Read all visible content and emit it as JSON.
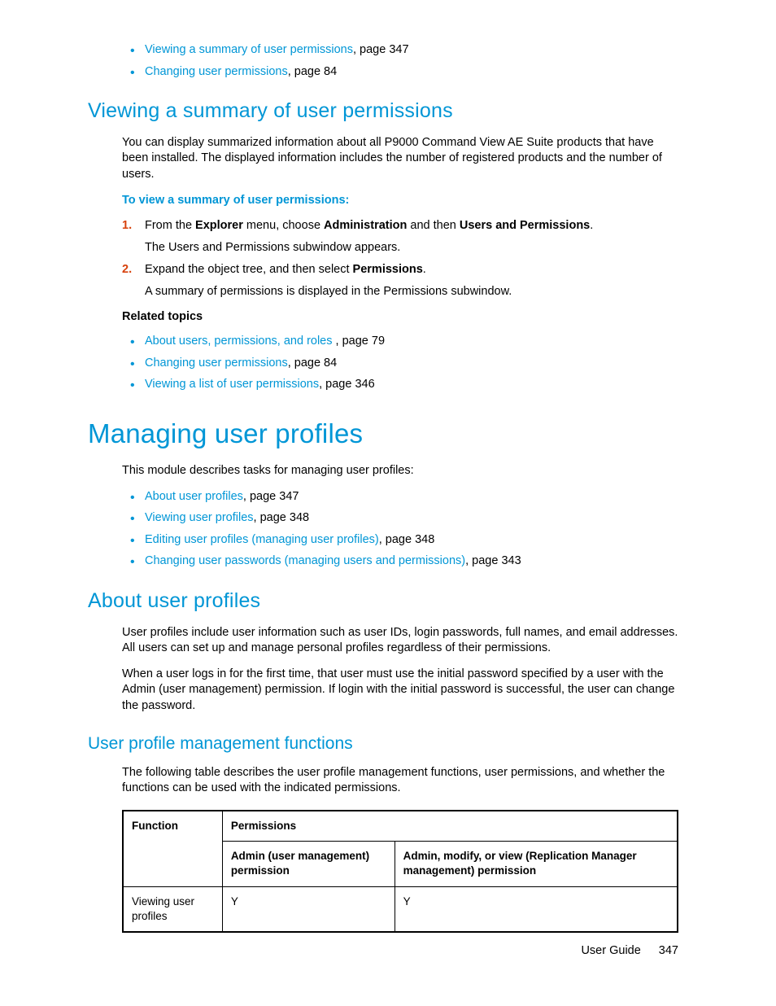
{
  "topLinks": [
    {
      "text": "Viewing a summary of user permissions",
      "suffix": ", page 347"
    },
    {
      "text": "Changing user permissions",
      "suffix": ", page 84"
    }
  ],
  "sec1": {
    "heading": "Viewing a summary of user permissions",
    "intro": "You can display summarized information about all P9000 Command View AE Suite products that have been installed. The displayed information includes the number of registered products and the number of users.",
    "instrHead": "To view a summary of user permissions:",
    "step1_a": "From the ",
    "step1_b": "Explorer",
    "step1_c": " menu, choose ",
    "step1_d": "Administration",
    "step1_e": " and then ",
    "step1_f": "Users and Permissions",
    "step1_g": ".",
    "step1_sub": "The Users and Permissions subwindow appears.",
    "step2_a": "Expand the object tree, and then select ",
    "step2_b": "Permissions",
    "step2_c": ".",
    "step2_sub": "A summary of permissions is displayed in the Permissions subwindow.",
    "relatedHead": "Related topics",
    "related": [
      {
        "text": "About users, permissions, and roles ",
        "suffix": ", page 79"
      },
      {
        "text": "Changing user permissions",
        "suffix": ", page 84"
      },
      {
        "text": "Viewing a list of user permissions",
        "suffix": ", page 346"
      }
    ]
  },
  "sec2": {
    "heading": "Managing user profiles",
    "intro": "This module describes tasks for managing user profiles:",
    "links": [
      {
        "text": "About user profiles",
        "suffix": ", page 347"
      },
      {
        "text": "Viewing user profiles",
        "suffix": ", page 348"
      },
      {
        "text": "Editing user profiles (managing user profiles)",
        "suffix": ", page 348"
      },
      {
        "text": "Changing user passwords (managing users and permissions)",
        "suffix": ", page 343"
      }
    ]
  },
  "sec3": {
    "heading": "About user profiles",
    "p1": "User profiles include user information such as user IDs, login passwords, full names, and email addresses. All users can set up and manage personal profiles regardless of their permissions.",
    "p2": "When a user logs in for the first time, that user must use the initial password specified by a user with the Admin (user management) permission. If login with the initial password is successful, the user can change the password."
  },
  "sec4": {
    "heading": "User profile management functions",
    "intro": "The following table describes the user profile management functions, user permissions, and whether the functions can be used with the indicated permissions.",
    "table": {
      "h_func": "Function",
      "h_perm": "Permissions",
      "h_c1": "Admin (user management) permission",
      "h_c2": "Admin, modify, or view (Replication Manager management) permission",
      "r1_func": "Viewing user profiles",
      "r1_c1": "Y",
      "r1_c2": "Y"
    }
  },
  "footer": {
    "label": "User Guide",
    "page": "347"
  }
}
